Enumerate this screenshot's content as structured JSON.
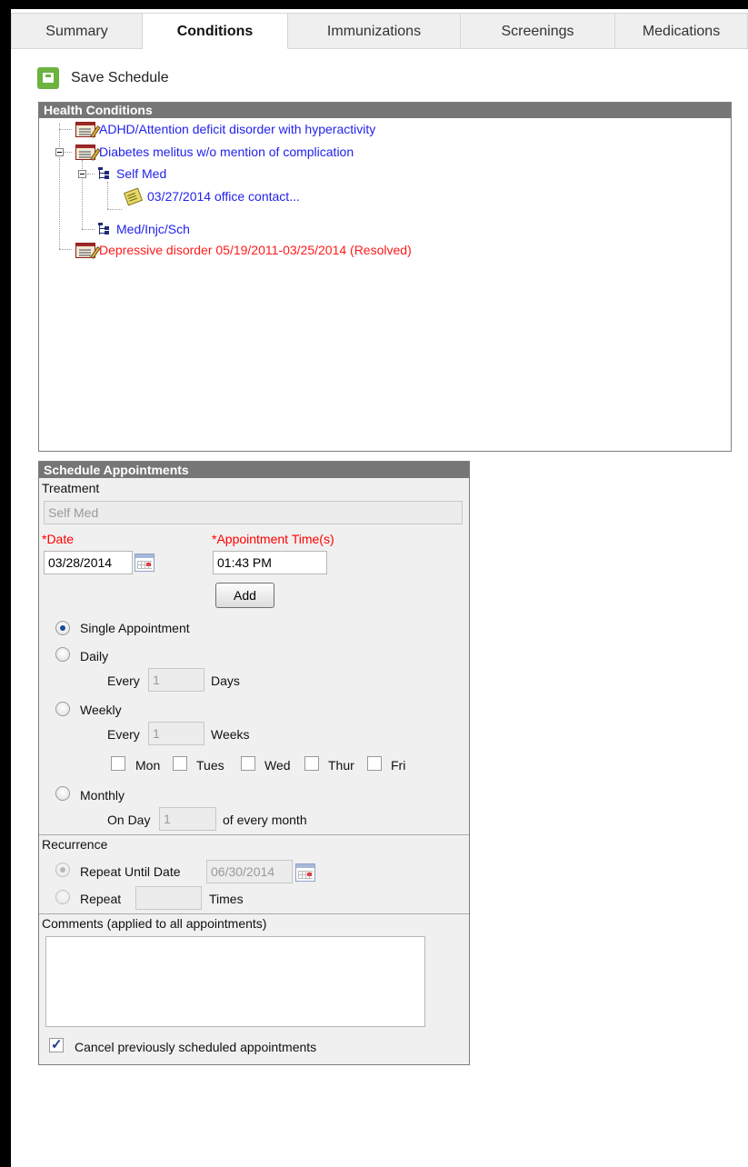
{
  "tabs": [
    {
      "label": "Summary"
    },
    {
      "label": "Conditions"
    },
    {
      "label": "Immunizations"
    },
    {
      "label": "Screenings"
    },
    {
      "label": "Medications"
    }
  ],
  "toolbar": {
    "save_label": "Save Schedule"
  },
  "health_conditions": {
    "title": "Health Conditions",
    "tree": {
      "n1": "ADHD/Attention deficit disorder with hyperactivity",
      "n2": "Diabetes melitus w/o mention of complication",
      "n3": "Self Med",
      "n4": "03/27/2014 office contact...",
      "n5": "Med/Injc/Sch",
      "n6": "Depressive disorder 05/19/2011-03/25/2014 (Resolved)"
    }
  },
  "schedule": {
    "title": "Schedule Appointments",
    "treatment_label": "Treatment",
    "treatment_value": "Self Med",
    "date_label": "*Date",
    "date_value": "03/28/2014",
    "time_label": "*Appointment Time(s)",
    "time_value": "01:43 PM",
    "add_label": "Add",
    "single_label": "Single Appointment",
    "daily_label": "Daily",
    "every_label": "Every",
    "daily_value": "1",
    "days_label": "Days",
    "weekly_label": "Weekly",
    "weekly_value": "1",
    "weeks_label": "Weeks",
    "days": [
      "Mon",
      "Tues",
      "Wed",
      "Thur",
      "Fri"
    ],
    "monthly_label": "Monthly",
    "on_day_label": "On Day",
    "monthly_value": "1",
    "of_every_month_label": "of every month",
    "recurrence_label": "Recurrence",
    "repeat_until_label": "Repeat Until Date",
    "repeat_until_value": "06/30/2014",
    "repeat_label": "Repeat",
    "repeat_value": "",
    "times_label": "Times",
    "comments_label": "Comments (applied to all appointments)",
    "comments_value": "",
    "cancel_label": "Cancel previously scheduled appointments"
  },
  "state": {
    "active_tab": "Conditions",
    "frequency": "Single Appointment",
    "recurrence": "Repeat Until Date",
    "cancel_checked": true
  },
  "colors": {
    "header_gray": "#767676",
    "link_blue": "#2222ee",
    "resolved_red": "#ff1a1a",
    "save_green": "#6cb33f"
  }
}
